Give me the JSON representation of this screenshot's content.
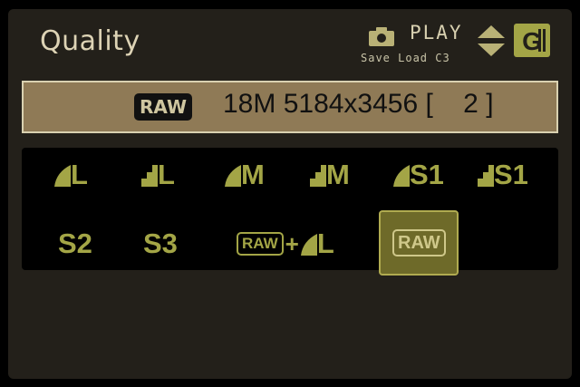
{
  "header": {
    "title": "Quality",
    "play_label": "PLAY",
    "sub_label": "Save Load C3"
  },
  "info_bar": {
    "format_badge": "RAW",
    "details": "18M 5184x3456 [    2 ]"
  },
  "options": [
    {
      "id": "fine-l",
      "label": "L",
      "quality": "fine"
    },
    {
      "id": "normal-l",
      "label": "L",
      "quality": "normal"
    },
    {
      "id": "fine-m",
      "label": "M",
      "quality": "fine"
    },
    {
      "id": "normal-m",
      "label": "M",
      "quality": "normal"
    },
    {
      "id": "fine-s1",
      "label": "S1",
      "quality": "fine"
    },
    {
      "id": "normal-s1",
      "label": "S1",
      "quality": "normal"
    },
    {
      "id": "s2",
      "label": "S2"
    },
    {
      "id": "s3",
      "label": "S3"
    },
    {
      "id": "raw-plus-l",
      "raw": "RAW",
      "plus": "+",
      "label": "L",
      "quality": "fine"
    },
    {
      "id": "raw",
      "label": "RAW",
      "selected": true
    }
  ],
  "colors": {
    "accent": "#a3a546",
    "selected_bg": "#6e6a29",
    "info_bar_bg": "#8f7a56"
  },
  "icons": [
    "camera-icon",
    "up-down-arrows-icon",
    "memory-card-icon",
    "fine-quality-icon",
    "normal-quality-icon"
  ]
}
